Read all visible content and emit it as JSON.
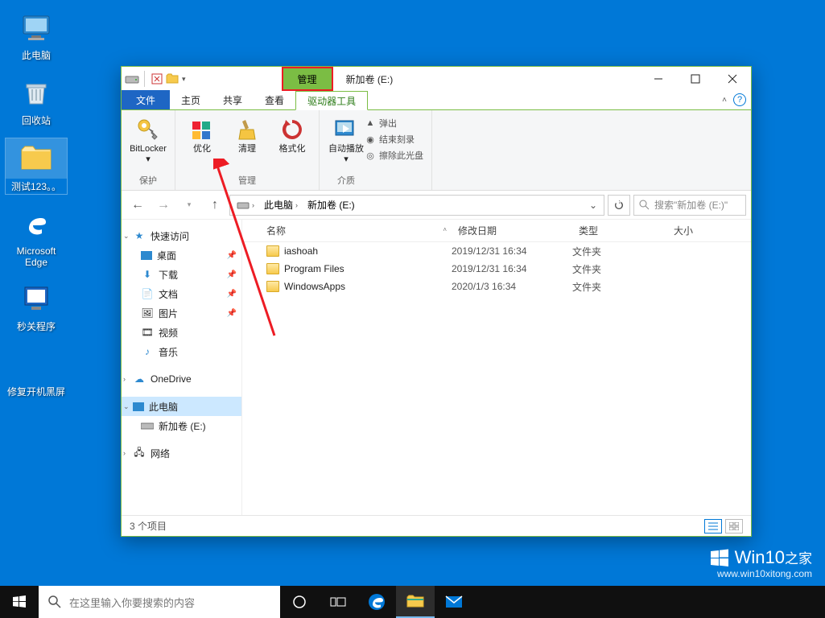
{
  "desktop": {
    "icons": [
      {
        "label": "此电脑"
      },
      {
        "label": "回收站"
      },
      {
        "label": "测试123。。"
      },
      {
        "label": "Microsoft Edge"
      },
      {
        "label": "秒关程序"
      },
      {
        "label": "修复开机黑屏"
      }
    ]
  },
  "window": {
    "manage_tab": "管理",
    "title": "新加卷 (E:)",
    "tabs": {
      "file": "文件",
      "home": "主页",
      "share": "共享",
      "view": "查看",
      "drive": "驱动器工具"
    },
    "ribbon": {
      "bitlocker": "BitLocker",
      "optimize": "优化",
      "cleanup": "清理",
      "format": "格式化",
      "autorun": "自动播放",
      "eject": "弹出",
      "endburn": "结束刻录",
      "erase": "擦除此光盘",
      "grp_protect": "保护",
      "grp_manage": "管理",
      "grp_media": "介质"
    },
    "breadcrumbs": [
      "此电脑",
      "新加卷 (E:)"
    ],
    "search_ph": "搜索\"新加卷 (E:)\"",
    "columns": {
      "name": "名称",
      "date": "修改日期",
      "type": "类型",
      "size": "大小"
    },
    "files": [
      {
        "name": "iashoah",
        "date": "2019/12/31 16:34",
        "type": "文件夹"
      },
      {
        "name": "Program Files",
        "date": "2019/12/31 16:34",
        "type": "文件夹"
      },
      {
        "name": "WindowsApps",
        "date": "2020/1/3 16:34",
        "type": "文件夹"
      }
    ],
    "nav": {
      "quick": "快速访问",
      "desktop": "桌面",
      "downloads": "下载",
      "documents": "文档",
      "pictures": "图片",
      "videos": "视频",
      "music": "音乐",
      "onedrive": "OneDrive",
      "thispc": "此电脑",
      "volume": "新加卷 (E:)",
      "network": "网络"
    },
    "status": "3 个项目"
  },
  "taskbar": {
    "search_ph": "在这里输入你要搜索的内容"
  },
  "watermark": {
    "brand": "Win10",
    "suffix": "之家",
    "url": "www.win10xitong.com"
  }
}
